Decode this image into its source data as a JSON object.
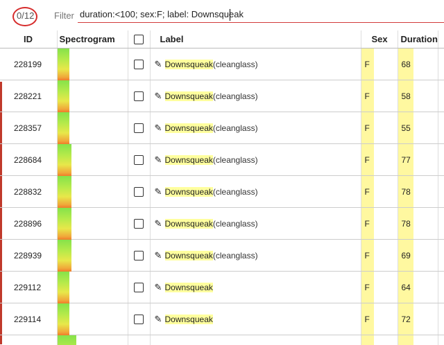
{
  "toolbar": {
    "count": "0/12",
    "filter_label": "Filter",
    "filter_value": "duration:<100; sex:F; label: Downsqueak"
  },
  "table": {
    "headers": {
      "id": "ID",
      "spectrogram": "Spectrogram",
      "label": "Label",
      "sex": "Sex",
      "duration": "Duration"
    },
    "rows": [
      {
        "id": "228199",
        "label_main": "Downsqueak",
        "label_extra": "(cleanglass)",
        "sex": "F",
        "duration": "68"
      },
      {
        "id": "228221",
        "label_main": "Downsqueak",
        "label_extra": "(cleanglass)",
        "sex": "F",
        "duration": "58"
      },
      {
        "id": "228357",
        "label_main": "Downsqueak",
        "label_extra": "(cleanglass)",
        "sex": "F",
        "duration": "55"
      },
      {
        "id": "228684",
        "label_main": "Downsqueak",
        "label_extra": "(cleanglass)",
        "sex": "F",
        "duration": "77"
      },
      {
        "id": "228832",
        "label_main": "Downsqueak",
        "label_extra": "(cleanglass)",
        "sex": "F",
        "duration": "78"
      },
      {
        "id": "228896",
        "label_main": "Downsqueak",
        "label_extra": "(cleanglass)",
        "sex": "F",
        "duration": "78"
      },
      {
        "id": "228939",
        "label_main": "Downsqueak",
        "label_extra": "(cleanglass)",
        "sex": "F",
        "duration": "69"
      },
      {
        "id": "229112",
        "label_main": "Downsqueak",
        "label_extra": "",
        "sex": "F",
        "duration": "64"
      },
      {
        "id": "229114",
        "label_main": "Downsqueak",
        "label_extra": "",
        "sex": "F",
        "duration": "72"
      }
    ]
  },
  "icons": {
    "edit": "pencil-icon"
  },
  "colors": {
    "highlight": "#ffff9e",
    "count_circle": "#d62b2b",
    "filter_underline": "#d23a3a"
  }
}
